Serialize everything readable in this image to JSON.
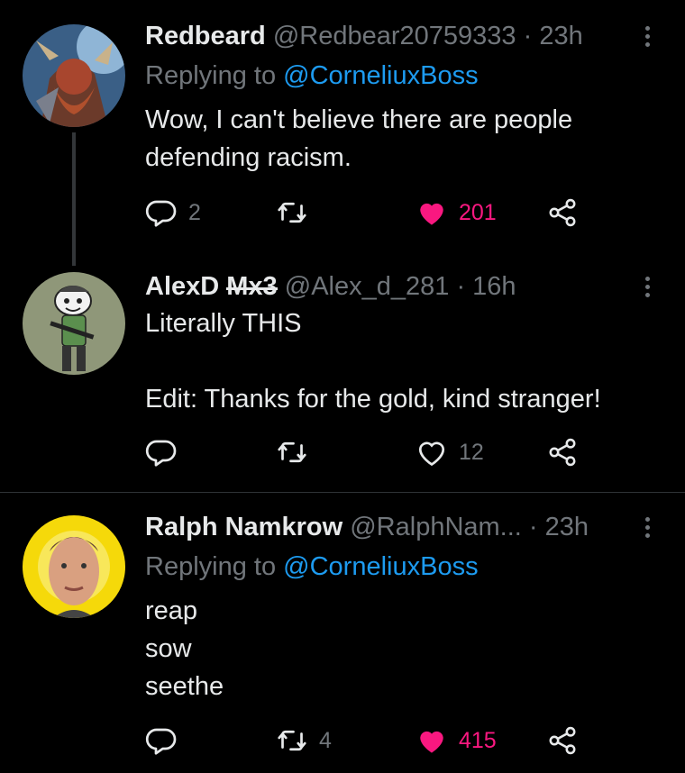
{
  "tweets": [
    {
      "name": "Redbeard",
      "handle": "@Redbear20759333",
      "dot": "·",
      "time": "23h",
      "replying_prefix": "Replying to",
      "replying_to": "@CorneliuxBoss",
      "text": "Wow, I can't believe there are people\ndefending racism.",
      "reply_count": "2",
      "retweet_count": "",
      "like_count": "201",
      "liked": true
    },
    {
      "name": "AlexD ",
      "name_struck": "Mx3",
      "handle": "@Alex_d_281",
      "dot": "·",
      "time": "16h",
      "text": "Literally THIS\n\nEdit: Thanks for the gold, kind stranger!",
      "reply_count": "",
      "retweet_count": "",
      "like_count": "12",
      "liked": false
    },
    {
      "name": "Ralph Namkrow",
      "handle": "@RalphNam...",
      "dot": "·",
      "time": "23h",
      "replying_prefix": "Replying to",
      "replying_to": "@CorneliuxBoss",
      "text": "reap\nsow\nseethe",
      "reply_count": "",
      "retweet_count": "4",
      "like_count": "415",
      "liked": true
    }
  ],
  "colors": {
    "accent": "#1d9bf0",
    "like": "#f91880",
    "muted": "#71767b",
    "text": "#e7e9ea",
    "bg": "#000000"
  },
  "icons": [
    "reply-icon",
    "retweet-icon",
    "heart-icon",
    "share-icon",
    "more-icon"
  ]
}
